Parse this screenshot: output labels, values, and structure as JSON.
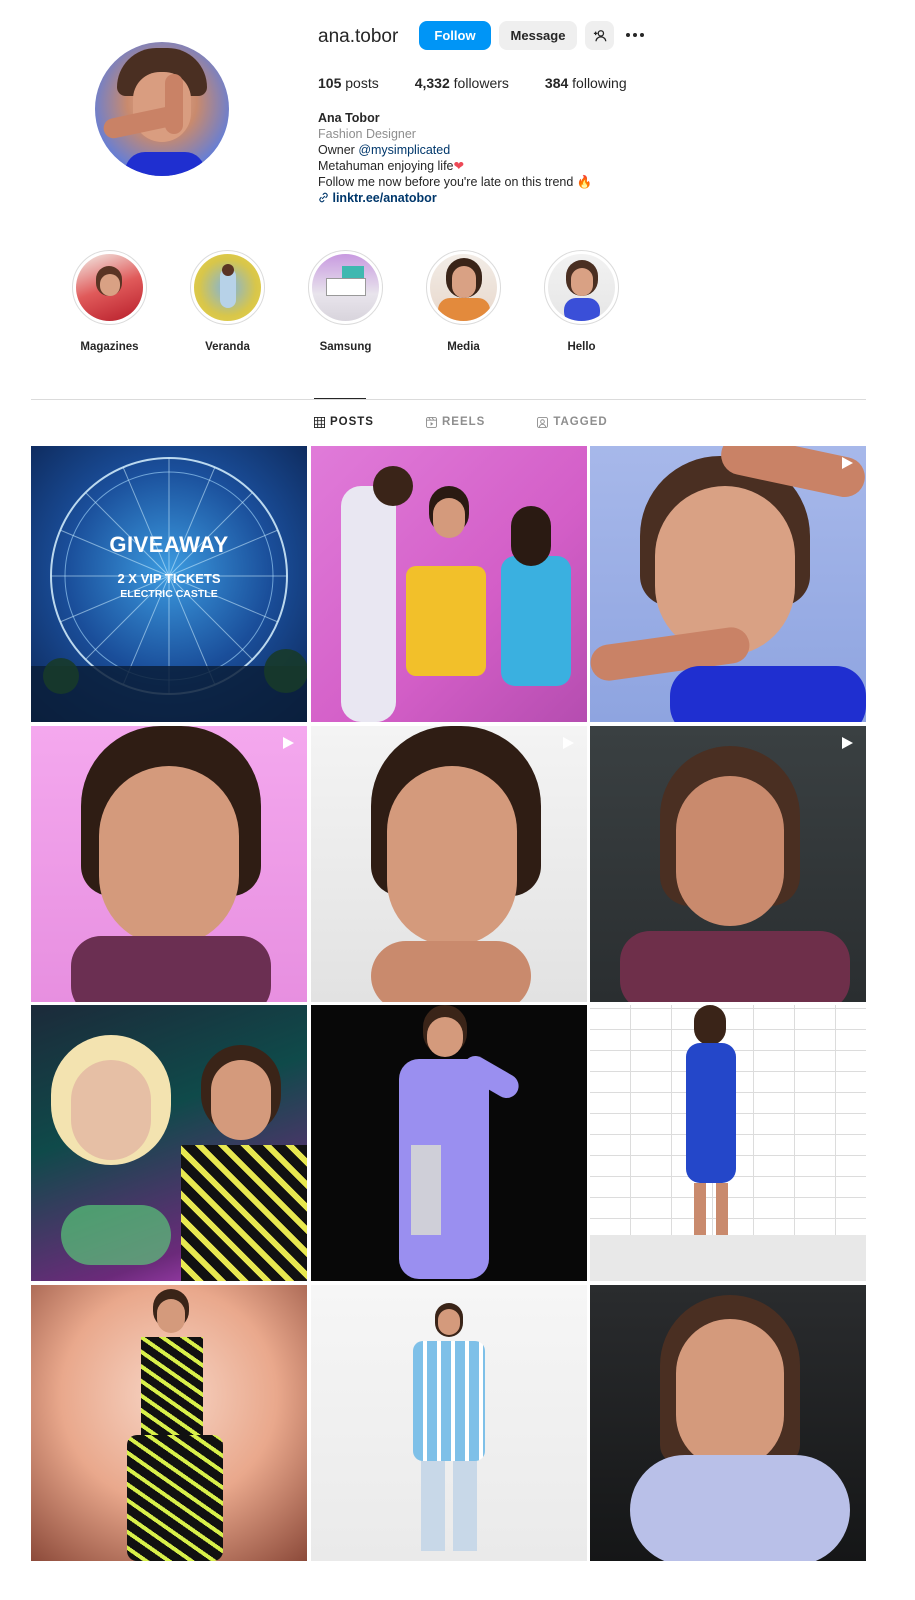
{
  "profile": {
    "username": "ana.tobor",
    "follow_label": "Follow",
    "message_label": "Message",
    "add_icon": "person-add-icon",
    "more_icon": "more-horizontal-icon"
  },
  "stats": {
    "posts_count": "105",
    "posts_label": "posts",
    "followers_count": "4,332",
    "followers_label": "followers",
    "following_count": "384",
    "following_label": "following"
  },
  "bio": {
    "name": "Ana Tobor",
    "category": "Fashion Designer",
    "owner_prefix": "Owner",
    "mention": "@mysimplicated",
    "line2": "Metahuman enjoying life",
    "line3": "Follow me now before you're late on this trend",
    "link": "linktr.ee/anatobor",
    "heart_emoji": "❤",
    "fire_emoji": "🔥"
  },
  "highlights": [
    {
      "label": "Magazines",
      "color": "#d44a4a"
    },
    {
      "label": "Veranda",
      "color": "#e8d24a"
    },
    {
      "label": "Samsung",
      "color": "#b77ed1"
    },
    {
      "label": "Media",
      "color": "#e39a60"
    },
    {
      "label": "Hello",
      "color": "#dcdcdc"
    }
  ],
  "tabs": {
    "posts": "POSTS",
    "reels": "REELS",
    "tagged": "TAGGED"
  },
  "posts": {
    "giveaway_title": "GIVEAWAY",
    "giveaway_sub1": "2 X VIP TICKETS",
    "giveaway_sub2": "ELECTRIC CASTLE"
  },
  "colors": {
    "accent": "#0095f6",
    "link": "#00376b"
  }
}
